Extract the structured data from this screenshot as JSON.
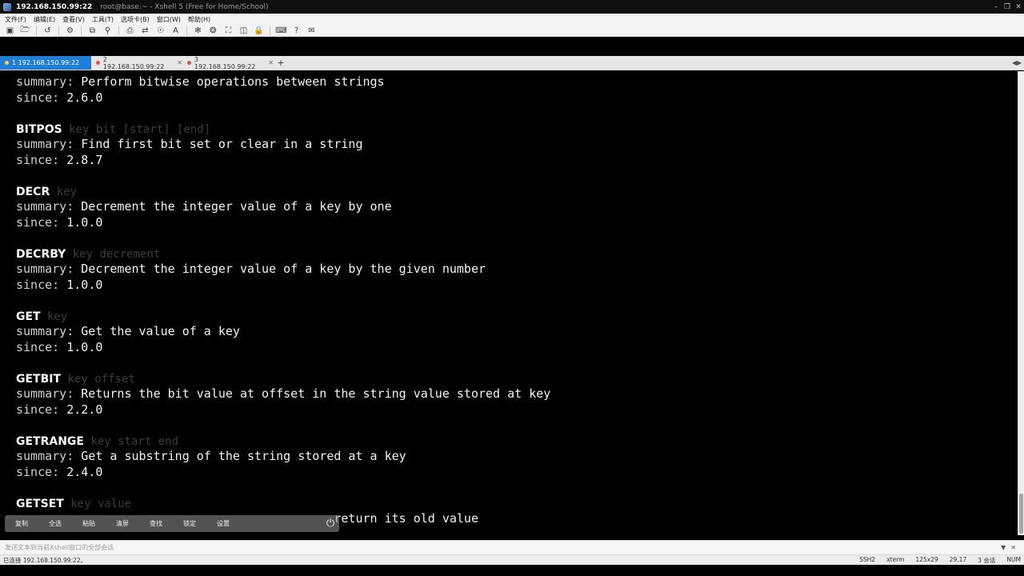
{
  "window": {
    "host": "192.168.150.99:22",
    "title_rest": "root@base:~ - Xshell 5 (Free for Home/School)"
  },
  "menu": [
    "文件(F)",
    "编辑(E)",
    "查看(V)",
    "工具(T)",
    "选项卡(B)",
    "窗口(W)",
    "帮助(H)"
  ],
  "tabs": [
    {
      "label": "1 192.168.150.99:22",
      "active": true
    },
    {
      "label": "2 192.168.150.99:22",
      "active": false
    },
    {
      "label": "3 192.168.150.99:22",
      "active": false
    }
  ],
  "terminal": {
    "line1_label": "summary:",
    "line1_text": " Perform bitwise operations between strings",
    "line2_label": "since:",
    "line2_text": " 2.6.0",
    "entries": [
      {
        "cmd": "BITPOS",
        "args": " key bit [start] [end]",
        "summary": " Find first bit set or clear in a string",
        "since": " 2.8.7"
      },
      {
        "cmd": "DECR",
        "args": " key",
        "summary": " Decrement the integer value of a key by one",
        "since": " 1.0.0"
      },
      {
        "cmd": "DECRBY",
        "args": " key decrement",
        "summary": " Decrement the integer value of a key by the given number",
        "since": " 1.0.0"
      },
      {
        "cmd": "GET",
        "args": " key",
        "summary": " Get the value of a key",
        "since": " 1.0.0"
      },
      {
        "cmd": "GETBIT",
        "args": " key offset",
        "summary": " Returns the bit value at offset in the string value stored at key",
        "since": " 2.2.0"
      },
      {
        "cmd": "GETRANGE",
        "args": " key start end",
        "summary": " Get a substring of the string stored at a key",
        "since": " 2.4.0"
      }
    ],
    "last_cmd": "GETSET",
    "last_args": " key value",
    "last_partial": "return its old value",
    "summary_label": "summary:",
    "since_label": "since:"
  },
  "quickbar": [
    "复制",
    "全选",
    "粘贴",
    "清屏",
    "查找",
    "锁定",
    "设置"
  ],
  "compose": {
    "placeholder": "发送文本到当前Xshell窗口的全部会话"
  },
  "status": {
    "connection": "已连接 192.168.150.99:22。",
    "ssh": "SSH2",
    "term": "xterm",
    "size": "125x29",
    "cursor": "29,17",
    "sessions": "3 会话",
    "caps": "NUM"
  }
}
